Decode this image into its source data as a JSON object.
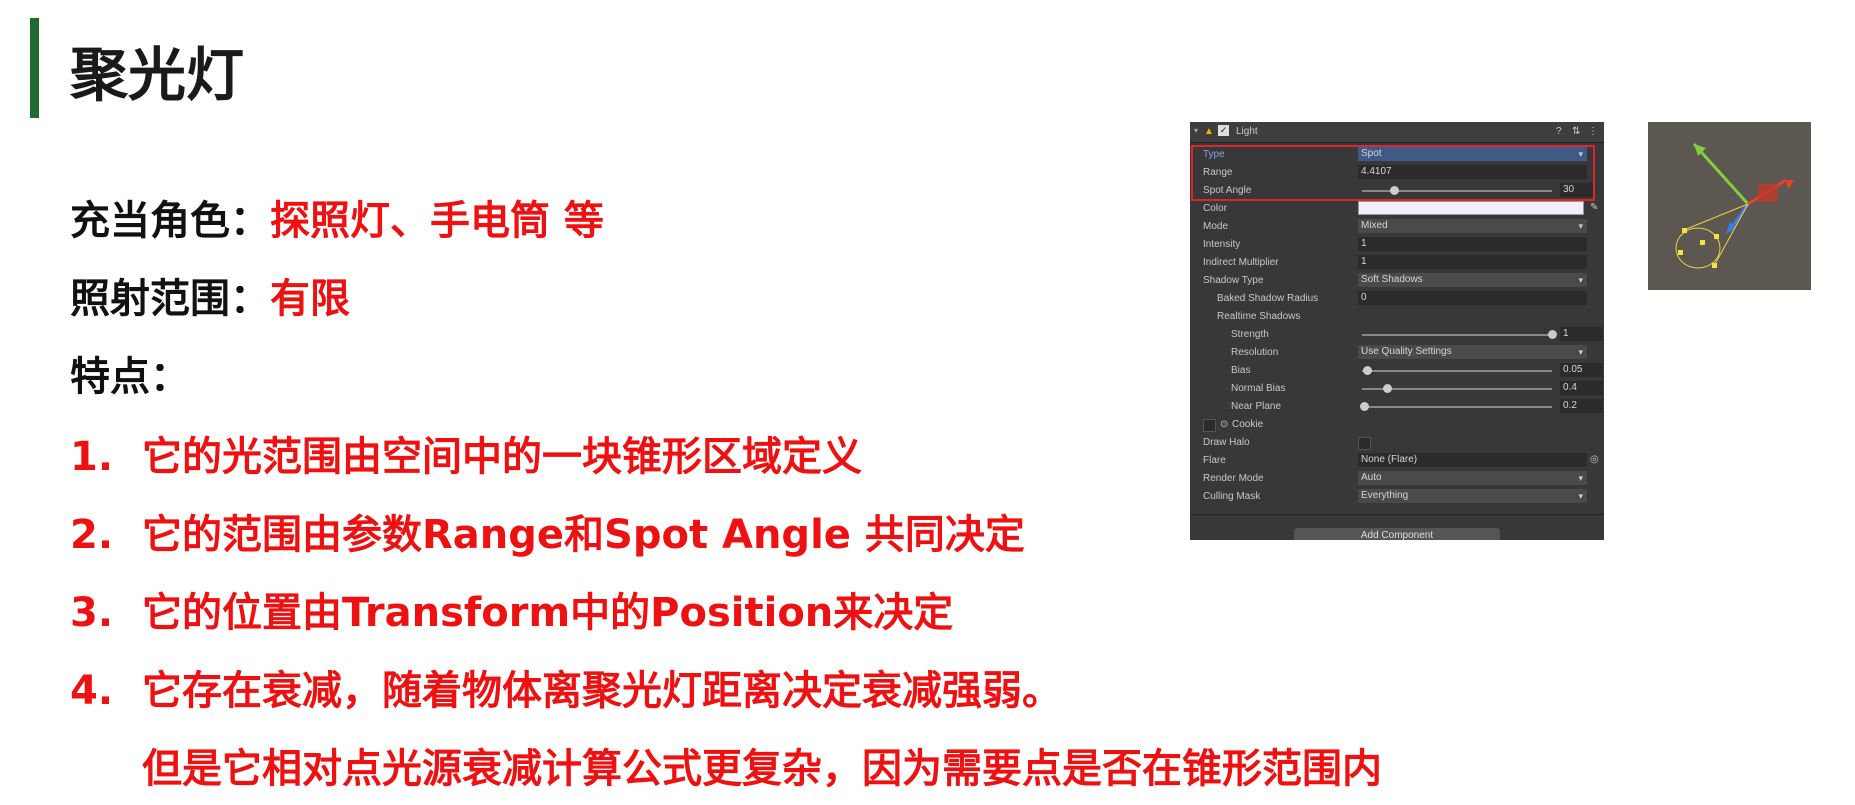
{
  "slide": {
    "title": "聚光灯",
    "role_label": "充当角色：",
    "role_value": "探照灯、手电筒 等",
    "range_label": "照射范围：",
    "range_value": "有限",
    "features_label": "特点：",
    "items": [
      {
        "num": "1.",
        "text": "它的光范围由空间中的一块锥形区域定义"
      },
      {
        "num": "2.",
        "text": "它的范围由参数Range和Spot Angle 共同决定"
      },
      {
        "num": "3.",
        "text": "它的位置由Transform中的Position来决定"
      },
      {
        "num": "4.",
        "text": "它存在衰减，随着物体离聚光灯距离决定衰减强弱。"
      }
    ],
    "item4_continuation": "但是它相对点光源衰减计算公式更复杂，因为需要点是否在锥形范围内"
  },
  "inspector": {
    "component_name": "Light",
    "header_icons": [
      "help-icon",
      "preset-icon",
      "menu-icon"
    ],
    "type_label": "Type",
    "type_value": "Spot",
    "range_label": "Range",
    "range_value": "4.4107",
    "spot_angle_label": "Spot Angle",
    "spot_angle_value": "30",
    "spot_angle_fraction": 0.15,
    "color_label": "Color",
    "color_value": "#f2eef8",
    "mode_label": "Mode",
    "mode_value": "Mixed",
    "intensity_label": "Intensity",
    "intensity_value": "1",
    "indirect_label": "Indirect Multiplier",
    "indirect_value": "1",
    "shadow_type_label": "Shadow Type",
    "shadow_type_value": "Soft Shadows",
    "baked_radius_label": "Baked Shadow Radius",
    "baked_radius_value": "0",
    "realtime_label": "Realtime Shadows",
    "strength_label": "Strength",
    "strength_value": "1",
    "strength_fraction": 1.0,
    "resolution_label": "Resolution",
    "resolution_value": "Use Quality Settings",
    "bias_label": "Bias",
    "bias_value": "0.05",
    "bias_fraction": 0.02,
    "normal_bias_label": "Normal Bias",
    "normal_bias_value": "0.4",
    "normal_bias_fraction": 0.13,
    "near_plane_label": "Near Plane",
    "near_plane_value": "0.2",
    "near_plane_fraction": 0.0,
    "cookie_label": "Cookie",
    "draw_halo_label": "Draw Halo",
    "flare_label": "Flare",
    "flare_value": "None (Flare)",
    "render_mode_label": "Render Mode",
    "render_mode_value": "Auto",
    "culling_label": "Culling Mask",
    "culling_value": "Everything",
    "add_component_label": "Add Component"
  },
  "colors": {
    "accent": "#1f6b30",
    "red": "#ee1111",
    "highlight": "#e0242a"
  }
}
